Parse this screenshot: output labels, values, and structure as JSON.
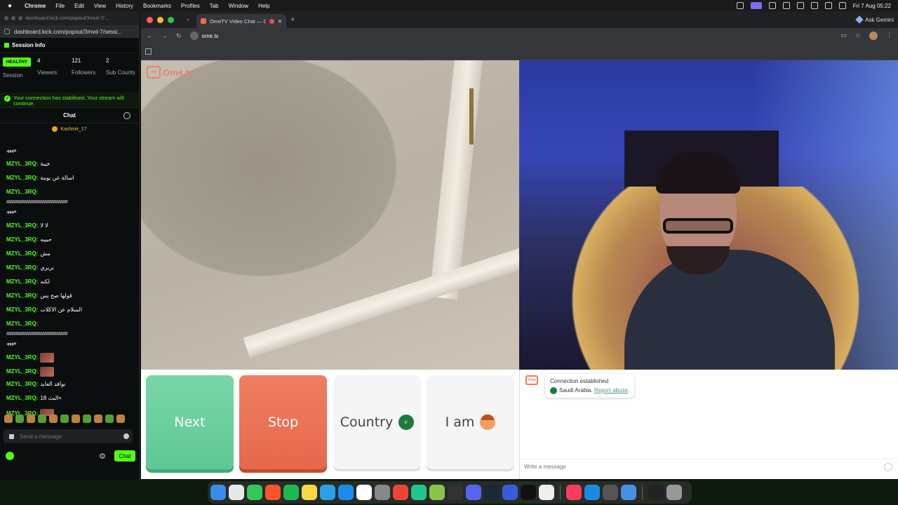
{
  "menubar": {
    "app": "Chrome",
    "items": [
      "File",
      "Edit",
      "View",
      "History",
      "Bookmarks",
      "Profiles",
      "Tab",
      "Window",
      "Help"
    ],
    "clock": "Fri 7 Aug 05:22"
  },
  "kick": {
    "tab_title": "dashboard.kick.com/popout/3mvd-7/...",
    "url": "dashboard.kick.com/popout/3mvd-7/sessi...",
    "session_title": "Session Info",
    "status_badge": "HEALTHY",
    "session_label": "Session",
    "viewers_value": "4",
    "viewers_label": "Viewers",
    "followers_value": "121",
    "followers_label": "Followers",
    "subs_value": "2",
    "subs_label": "Sub Counts",
    "notice": "Your connection has stabilised. Your stream will continue.",
    "chat_title": "Chat",
    "pinned_user": "Kashmir_17",
    "username": "MZYL_3RQ:",
    "messages": [
      "خيبة",
      "اسالة عن يومة",
      "",
      "لا لا",
      "حبيبه",
      "مش",
      "بربري",
      "لكنه",
      "قولها صح بس",
      "السلام عن الاكلات",
      "",
      "",
      "",
      "نوافد العابد",
      "البث 18+",
      ""
    ],
    "hash_line": "##############################",
    "top_fragment": "ھھھھ",
    "send_placeholder": "Send a message",
    "chat_button": "Chat"
  },
  "chrome": {
    "tab_title": "OmeTV Video Chat — Ome...",
    "url": "ome.tv",
    "gemini": "Ask Gemini"
  },
  "ometv": {
    "logo": "Ome.tv",
    "buttons": {
      "next": "Next",
      "stop": "Stop",
      "country": "Country",
      "iam": "I am"
    },
    "connection_status": "Connection established",
    "country_name": "Saudi Arabia.",
    "report_link": "Report abuse",
    "write_placeholder": "Write a message"
  },
  "colors": {
    "kick_green": "#53fc18",
    "ome_next": "#5fc894",
    "ome_stop": "#e6684c",
    "ome_orange": "#f27a5e"
  }
}
